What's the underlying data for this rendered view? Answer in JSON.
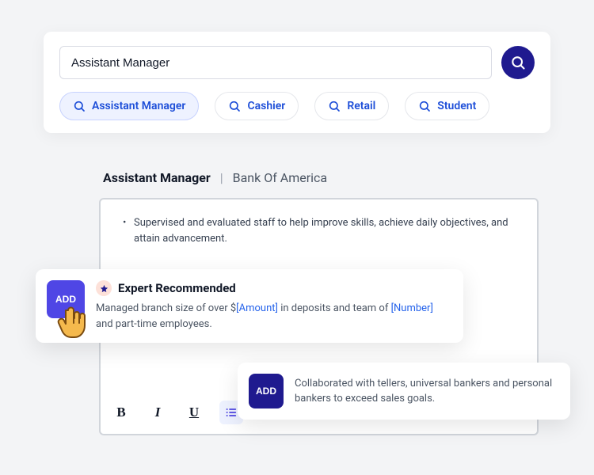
{
  "search": {
    "value": "Assistant Manager",
    "chips": [
      "Assistant Manager",
      "Cashier",
      "Retail",
      "Student"
    ]
  },
  "header": {
    "role": "Assistant Manager",
    "sep": "|",
    "company": "Bank Of America"
  },
  "editor": {
    "bullet1": "Supervised and evaluated staff to help improve skills, achieve daily objectives, and attain advancement."
  },
  "toolbar": {
    "bold": "B",
    "italic": "I",
    "underline": "U"
  },
  "recommendation1": {
    "add_label": "ADD",
    "badge": "Expert Recommended",
    "text_before": "Managed branch size of over $",
    "ph1": "[Amount]",
    "text_mid": " in deposits and team of ",
    "ph2": "[Number]",
    "text_after": " and part-time employees."
  },
  "recommendation2": {
    "add_label": "ADD",
    "text": "Collaborated with tellers, universal bankers and personal bankers to exceed sales goals."
  }
}
